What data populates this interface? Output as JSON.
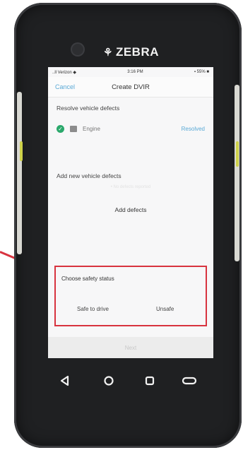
{
  "brand": {
    "name": "ZEBRA",
    "logo_glyph": "⚘"
  },
  "status_bar": {
    "carrier": "..ll Verizon ◆",
    "time": "3:16 PM",
    "battery": "▪ 55% ■"
  },
  "nav": {
    "cancel_label": "Cancel",
    "title": "Create DVIR"
  },
  "resolve_section": {
    "title": "Resolve vehicle defects",
    "defects": [
      {
        "name": "Engine",
        "status": "Resolved"
      }
    ]
  },
  "add_section": {
    "title": "Add new vehicle defects",
    "hint": "• No defects reported",
    "add_button": "Add defects"
  },
  "safety": {
    "label": "Choose safety status",
    "safe_label": "Safe to drive",
    "unsafe_label": "Unsafe"
  },
  "footer": {
    "next_label": "Next"
  },
  "colors": {
    "accent": "#5aa9d6",
    "highlight": "#d8333f",
    "success": "#2aa86b"
  },
  "android_nav": {
    "back_icon": "back-triangle-icon",
    "home_icon": "home-circle-icon",
    "recent_icon": "recent-square-icon",
    "menu_icon": "menu-pill-icon"
  }
}
